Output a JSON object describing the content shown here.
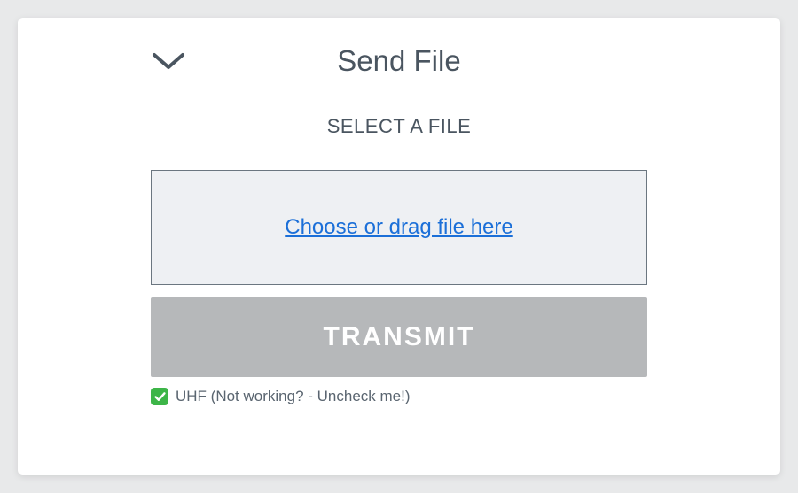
{
  "header": {
    "title": "Send File"
  },
  "main": {
    "subtitle": "SELECT A FILE",
    "dropzone_text": "Choose or drag file here",
    "transmit_label": "TRANSMIT"
  },
  "options": {
    "uhf_checked": true,
    "uhf_label": "UHF (Not working? - Uncheck me!)"
  }
}
